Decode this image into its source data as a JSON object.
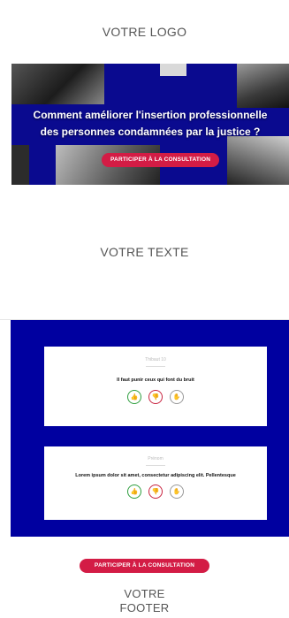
{
  "logo": {
    "text": "VOTRE LOGO"
  },
  "hero": {
    "title_line1": "Comment améliorer l'insertion professionnelle",
    "title_line2": "des personnes condamnées par la justice ?",
    "cta_label": "PARTICIPER À LA CONSULTATION"
  },
  "text_block": {
    "text": "VOTRE TEXTE"
  },
  "cards": [
    {
      "author": "Thibaut 10",
      "text": "Il faut punir ceux qui font du bruit",
      "votes": {
        "agree_icon": "thumbs-up-icon",
        "disagree_icon": "thumbs-down-icon",
        "neutral_icon": "hand-icon"
      }
    },
    {
      "author": "Prénom",
      "text": "Lorem ipsum dolor sit amet, consectetur adipiscing elit. Pellentesque",
      "votes": {
        "agree_icon": "thumbs-up-icon",
        "disagree_icon": "thumbs-down-icon",
        "neutral_icon": "hand-icon"
      }
    }
  ],
  "footer_cta": {
    "label": "PARTICIPER À LA CONSULTATION"
  },
  "footer": {
    "line1": "VOTRE",
    "line2": "FOOTER"
  },
  "colors": {
    "brand_blue": "#0000a0",
    "cta_red": "#d31c45",
    "agree": "#2e9e3e",
    "disagree": "#c8233f"
  }
}
